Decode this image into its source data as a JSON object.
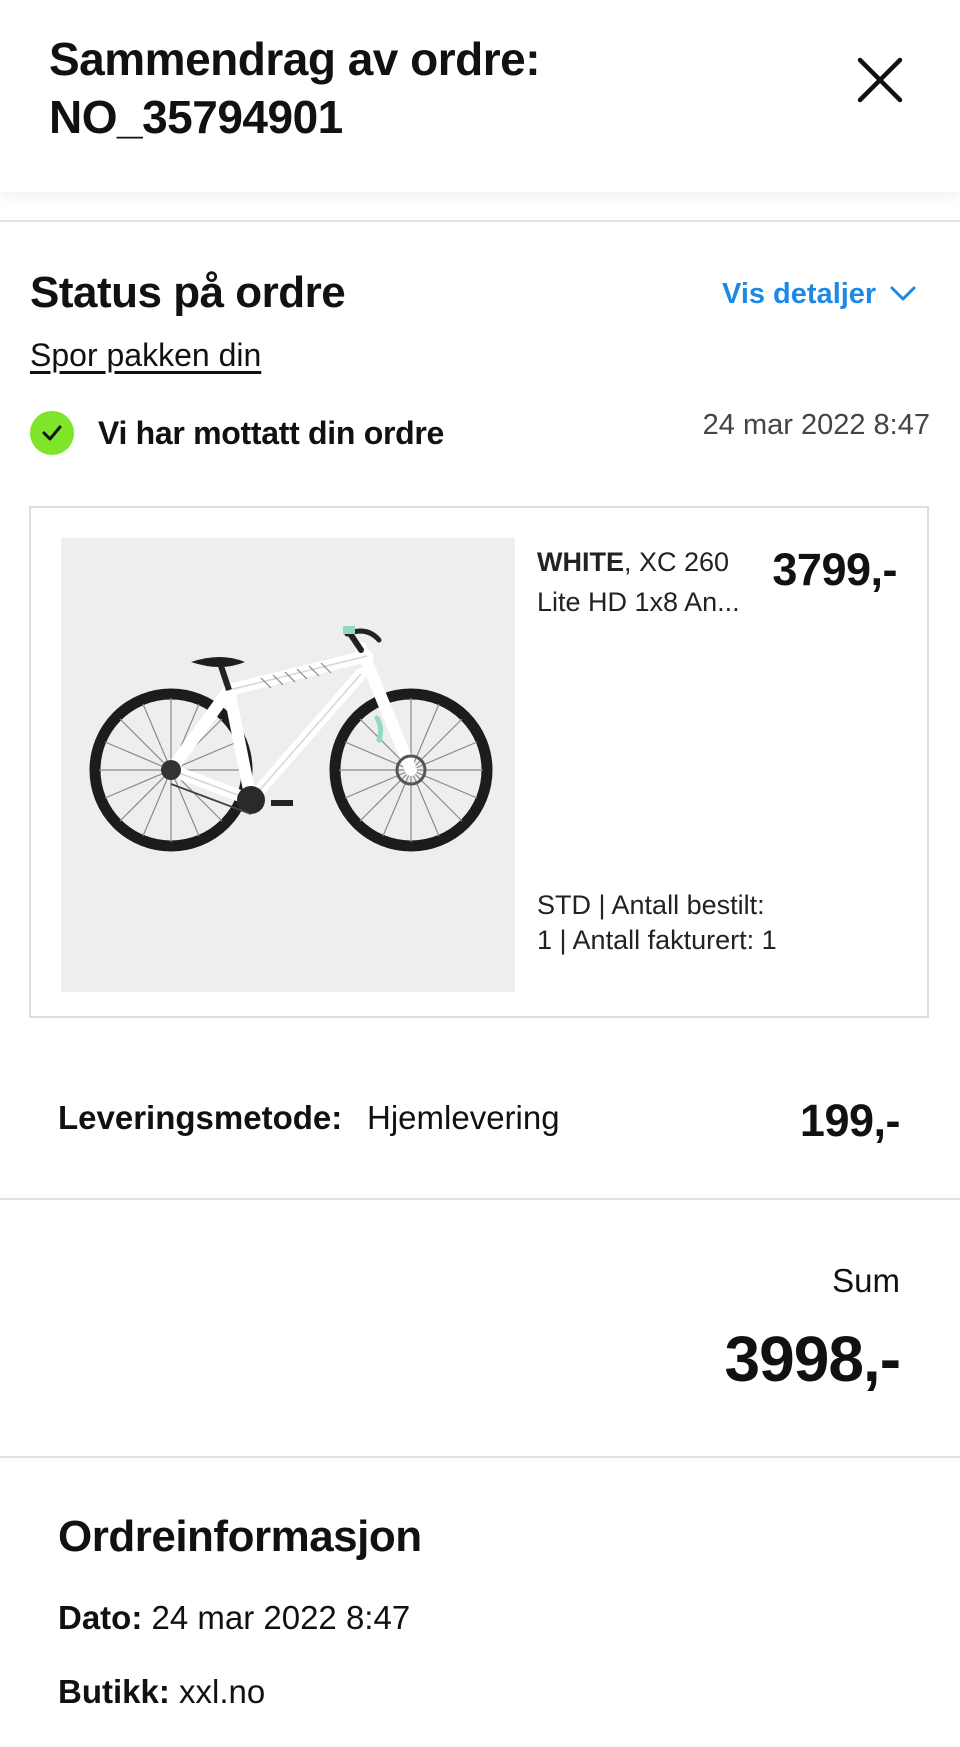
{
  "header": {
    "title_line1": "Sammendrag av ordre:",
    "title_line2": "NO_35794901",
    "close_icon": "close-icon"
  },
  "status": {
    "title": "Status på ordre",
    "details_label": "Vis detaljer",
    "track_link": "Spor pakken din",
    "received_text": "Vi har mottatt din ordre",
    "received_date": "24 mar 2022 8:47",
    "check_color": "#7ee52a",
    "link_color": "#1e88e5"
  },
  "product": {
    "brand": "WHITE",
    "name_rest": ", XC 260 Lite HD 1x8 An...",
    "price": "3799,-",
    "meta": "STD | Antall bestilt: 1 | Antall fakturert: 1",
    "image": "bicycle-image"
  },
  "delivery": {
    "label": "Leveringsmetode:",
    "value": "Hjemlevering",
    "price": "199,-"
  },
  "summary": {
    "sum_label": "Sum",
    "sum_value": "3998,-"
  },
  "order_info": {
    "title": "Ordreinformasjon",
    "date_label": "Dato:",
    "date_value": "24 mar 2022 8:47",
    "store_label": "Butikk:",
    "store_value": "xxl.no"
  }
}
